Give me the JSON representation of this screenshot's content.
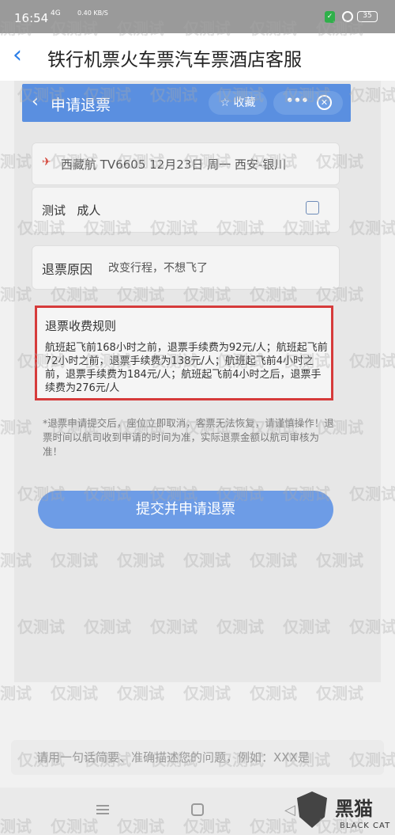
{
  "status_bar": {
    "time": "16:54",
    "signal": "4G",
    "net_speed": "0.40 KB/S",
    "battery": "35",
    "shield_color": "#2fb04a"
  },
  "header": {
    "back_icon": "chevron-left-icon",
    "title": "铁行机票火车票汽车票酒店客服"
  },
  "embedded": {
    "page_title": "申请退票",
    "favorite_label": "收藏",
    "more_label": "•••",
    "flight_info": "西藏航 TV6605 12月23日 周一 西安-银川",
    "passenger_name": "测试",
    "passenger_type": "成人",
    "reason_label": "退票原因",
    "reason_value": "改变行程，不想飞了",
    "rules_title": "退票收费规则",
    "rules_body": "航班起飞前168小时之前，退票手续费为92元/人；航班起飞前72小时之前，退票手续费为138元/人；航班起飞前4小时之前，退票手续费为184元/人；航班起飞前4小时之后，退票手续费为276元/人",
    "note": "*退票申请提交后，座位立即取消，客票无法恢复，请谨慎操作！退票时间以航司收到申请的时间为准，实际退票金额以航司审核为准！",
    "submit_label": "提交并申请退票"
  },
  "input": {
    "placeholder": "请用一句话简要、准确描述您的问题，例如：XXX是"
  },
  "watermark_text": "仅测试",
  "badge": {
    "cn": "黑猫",
    "en": "BLACK CAT"
  },
  "colors": {
    "accent": "#2a7ee8",
    "header_blue": "#5a8fe0",
    "rules_border": "#d63b3b"
  }
}
